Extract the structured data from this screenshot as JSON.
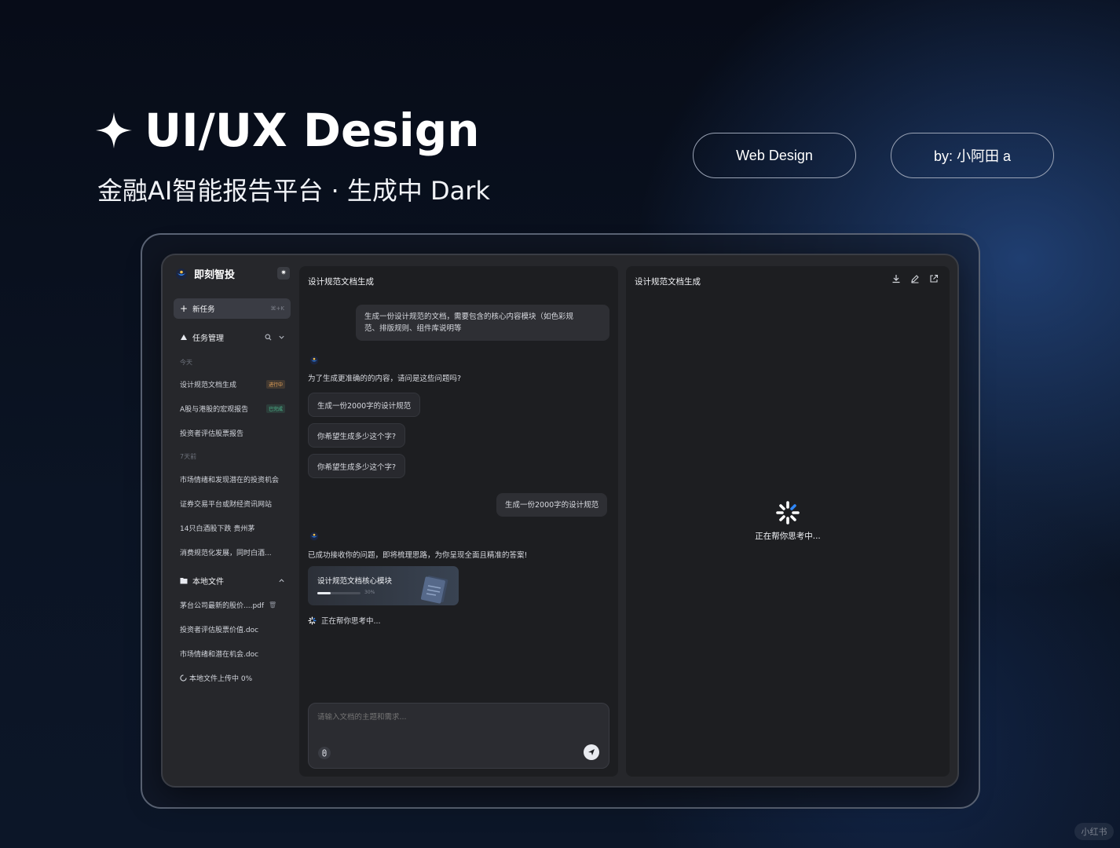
{
  "hero": {
    "title": "UI/UX Design",
    "subtitle": "金融AI智能报告平台 · 生成中 Dark",
    "pill_web": "Web Design",
    "pill_by": "by: 小阿田 a"
  },
  "app": {
    "brand": "即刻智投",
    "new_task": {
      "label": "新任务",
      "shortcut": "⌘+K"
    },
    "task_section": "任务管理",
    "today_label": "今天",
    "today_items": [
      {
        "label": "设计规范文档生成",
        "badge": "进行中"
      },
      {
        "label": "A股与港股的宏观报告",
        "badge": "已完成"
      },
      {
        "label": "投资者评估股票报告"
      }
    ],
    "week_label": "7天前",
    "week_items": [
      "市场情绪和发现潜在的投资机会",
      "证券交易平台或财经资讯网站",
      "14只白酒股下跌 贵州茅",
      "消费规范化发展，同时白酒..."
    ],
    "files_section": "本地文件",
    "files": [
      "茅台公司最新的股价....pdf",
      "投资者评估股票价值.doc",
      "市场情绪和潜在机会.doc"
    ],
    "upload_status": "本地文件上传中 0%"
  },
  "chat": {
    "title": "设计规范文档生成",
    "user_msg_1_line1": "生成一份设计规范的文档，需要包含的核心内容模块（如色彩规",
    "user_msg_1_line2": "范、排版规则、组件库说明等",
    "bot_msg_1": "为了生成更准确的的内容，请问是这些问题吗?",
    "options": [
      "生成一份2000字的设计规范",
      "你希望生成多少这个字?",
      "你希望生成多少这个字?"
    ],
    "user_msg_2": "生成一份2000字的设计规范",
    "bot_msg_2": "已成功接收你的问题，即将梳理思路，为你呈现全面且精准的答案!",
    "card_title": "设计规范文档核心模块",
    "card_progress": 0.3,
    "card_progress_label": "30%",
    "thinking": "正在帮你思考中...",
    "input_placeholder": "请输入文档的主题和需求..."
  },
  "preview": {
    "title": "设计规范文档生成",
    "loading_text": "正在帮你思考中..."
  },
  "watermark": "小红书",
  "colors": {
    "accent_blue": "#2f86f6",
    "badge_doing": "#e5a25a",
    "badge_done": "#4fbf93"
  },
  "icons": [
    "sparkle-icon",
    "logo-icon",
    "settings-icon",
    "plus-icon",
    "task-icon",
    "search-icon",
    "chevron-down-icon",
    "chevron-up-icon",
    "folder-icon",
    "trash-icon",
    "loading-icon",
    "attach-icon",
    "send-icon",
    "download-icon",
    "edit-icon",
    "external-link-icon",
    "spinner-icon",
    "document-icon"
  ]
}
